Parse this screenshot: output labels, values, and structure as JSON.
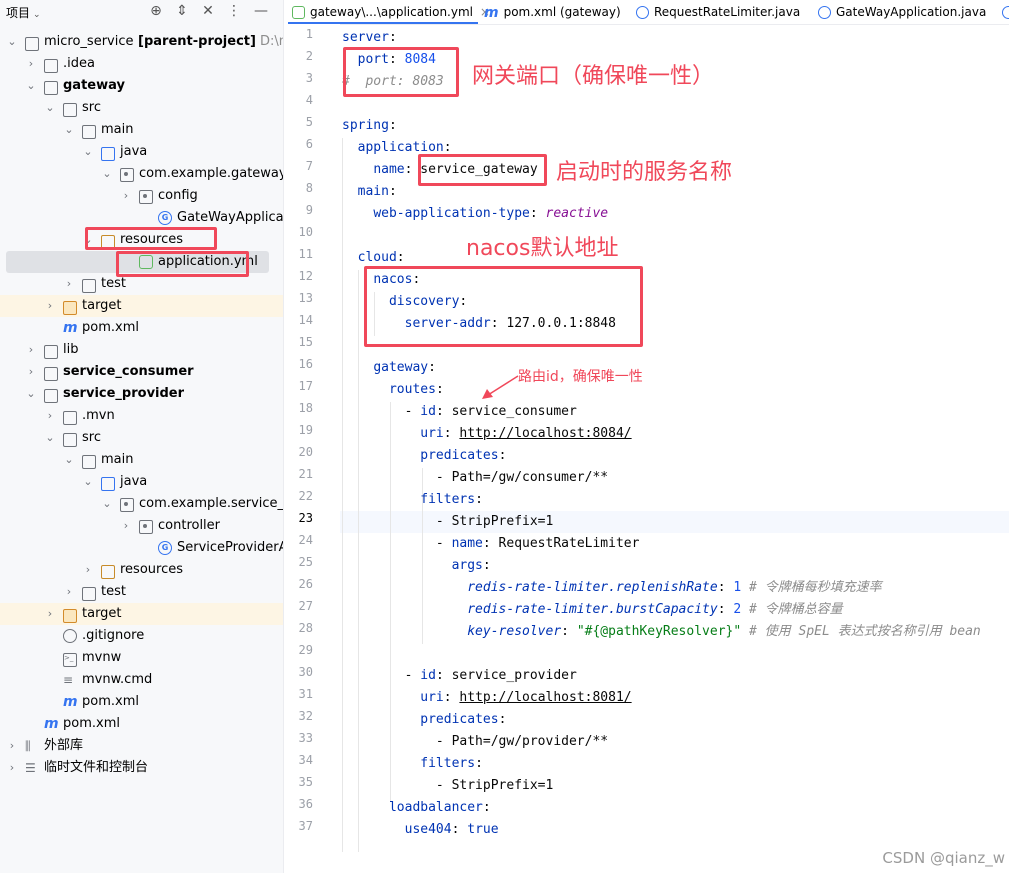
{
  "project_panel": {
    "title": "项目",
    "tree": [
      {
        "label": "micro_service",
        "bold_suffix": "[parent-project]",
        "sub": "D:\\mic",
        "icon": "module-folder-icon",
        "arrow": "▾"
      },
      {
        "label": ".idea",
        "icon": "folder-icon",
        "arrow": "›"
      },
      {
        "label": "gateway",
        "bold": true,
        "icon": "module-folder-icon",
        "arrow": "▾"
      },
      {
        "label": "src",
        "icon": "folder-icon",
        "arrow": "▾"
      },
      {
        "label": "main",
        "icon": "folder-icon",
        "arrow": "▾"
      },
      {
        "label": "java",
        "icon": "source-folder-icon",
        "arrow": "▾"
      },
      {
        "label": "com.example.gateway",
        "icon": "package-icon",
        "arrow": "▾"
      },
      {
        "label": "config",
        "icon": "package-icon",
        "arrow": "›"
      },
      {
        "label": "GateWayApplication",
        "icon": "spring-class-icon",
        "arrow": ""
      },
      {
        "label": "resources",
        "icon": "resources-folder-icon",
        "arrow": "▾"
      },
      {
        "label": "application.yml",
        "icon": "yaml-file-icon",
        "arrow": ""
      },
      {
        "label": "test",
        "icon": "folder-icon",
        "arrow": "›"
      },
      {
        "label": "target",
        "icon": "excluded-folder-icon",
        "arrow": "›"
      },
      {
        "label": "pom.xml",
        "icon": "maven-icon",
        "arrow": ""
      },
      {
        "label": "lib",
        "icon": "folder-icon",
        "arrow": "›"
      },
      {
        "label": "service_consumer",
        "bold": true,
        "icon": "module-folder-icon",
        "arrow": "›"
      },
      {
        "label": "service_provider",
        "bold": true,
        "icon": "module-folder-icon",
        "arrow": "▾"
      },
      {
        "label": ".mvn",
        "icon": "folder-icon",
        "arrow": "›"
      },
      {
        "label": "src",
        "icon": "folder-icon",
        "arrow": "▾"
      },
      {
        "label": "main",
        "icon": "folder-icon",
        "arrow": "▾"
      },
      {
        "label": "java",
        "icon": "source-folder-icon",
        "arrow": "▾"
      },
      {
        "label": "com.example.service_p",
        "icon": "package-icon",
        "arrow": "▾"
      },
      {
        "label": "controller",
        "icon": "package-icon",
        "arrow": "›"
      },
      {
        "label": "ServiceProviderApp",
        "icon": "spring-class-icon",
        "arrow": ""
      },
      {
        "label": "resources",
        "icon": "resources-folder-icon",
        "arrow": "›"
      },
      {
        "label": "test",
        "icon": "folder-icon",
        "arrow": "›"
      },
      {
        "label": "target",
        "icon": "excluded-folder-icon",
        "arrow": "›"
      },
      {
        "label": ".gitignore",
        "icon": "gitignore-icon",
        "arrow": ""
      },
      {
        "label": "mvnw",
        "icon": "terminal-file-icon",
        "arrow": ""
      },
      {
        "label": "mvnw.cmd",
        "icon": "text-file-icon",
        "arrow": ""
      },
      {
        "label": "pom.xml",
        "icon": "maven-icon",
        "arrow": ""
      },
      {
        "label": "pom.xml",
        "icon": "maven-icon",
        "arrow": ""
      },
      {
        "label": "外部库",
        "icon": "library-icon",
        "arrow": "›"
      },
      {
        "label": "临时文件和控制台",
        "icon": "scratches-icon",
        "arrow": "›"
      }
    ]
  },
  "tabs": [
    {
      "label": "gateway\\...\\application.yml",
      "icon": "yaml-file-icon",
      "active": true,
      "close": "×"
    },
    {
      "label": "pom.xml (gateway)",
      "icon": "maven-icon"
    },
    {
      "label": "RequestRateLimiter.java",
      "icon": "class-icon"
    },
    {
      "label": "GateWayApplication.java",
      "icon": "spring-class-icon"
    }
  ],
  "editor": {
    "current_line": 23,
    "line_numbers": [
      "1",
      "2",
      "3",
      "4",
      "5",
      "6",
      "7",
      "8",
      "9",
      "10",
      "11",
      "12",
      "13",
      "14",
      "15",
      "16",
      "17",
      "18",
      "19",
      "20",
      "21",
      "22",
      "23",
      "24",
      "25",
      "26",
      "27",
      "28",
      "29",
      "30",
      "31",
      "32",
      "33",
      "34",
      "35",
      "36",
      "37"
    ],
    "lines": [
      [
        {
          "t": "server",
          "c": "k"
        },
        {
          "t": ":"
        }
      ],
      [
        {
          "t": "  "
        },
        {
          "t": "port",
          "c": "k"
        },
        {
          "t": ": "
        },
        {
          "t": "8084",
          "c": "n"
        }
      ],
      [
        {
          "t": "#  port: 8083",
          "c": "cm"
        }
      ],
      [],
      [
        {
          "t": "spring",
          "c": "k"
        },
        {
          "t": ":"
        }
      ],
      [
        {
          "t": "  "
        },
        {
          "t": "application",
          "c": "k"
        },
        {
          "t": ":"
        }
      ],
      [
        {
          "t": "    "
        },
        {
          "t": "name",
          "c": "k"
        },
        {
          "t": ": "
        },
        {
          "t": "service_gateway"
        }
      ],
      [
        {
          "t": "  "
        },
        {
          "t": "main",
          "c": "k"
        },
        {
          "t": ":"
        }
      ],
      [
        {
          "t": "    "
        },
        {
          "t": "web-application-type",
          "c": "k"
        },
        {
          "t": ": "
        },
        {
          "t": "reactive",
          "c": "it"
        }
      ],
      [],
      [
        {
          "t": "  "
        },
        {
          "t": "cloud",
          "c": "k"
        },
        {
          "t": ":"
        }
      ],
      [
        {
          "t": "    "
        },
        {
          "t": "nacos",
          "c": "k"
        },
        {
          "t": ":"
        }
      ],
      [
        {
          "t": "      "
        },
        {
          "t": "discovery",
          "c": "k"
        },
        {
          "t": ":"
        }
      ],
      [
        {
          "t": "        "
        },
        {
          "t": "server-addr",
          "c": "k"
        },
        {
          "t": ": "
        },
        {
          "t": "127.0.0.1:8848"
        }
      ],
      [],
      [
        {
          "t": "    "
        },
        {
          "t": "gateway",
          "c": "k"
        },
        {
          "t": ":"
        }
      ],
      [
        {
          "t": "      "
        },
        {
          "t": "routes",
          "c": "k"
        },
        {
          "t": ":"
        }
      ],
      [
        {
          "t": "        - "
        },
        {
          "t": "id",
          "c": "k"
        },
        {
          "t": ": "
        },
        {
          "t": "service_consumer"
        }
      ],
      [
        {
          "t": "          "
        },
        {
          "t": "uri",
          "c": "k"
        },
        {
          "t": ": "
        },
        {
          "t": "http://localhost:8084/",
          "c": "u"
        }
      ],
      [
        {
          "t": "          "
        },
        {
          "t": "predicates",
          "c": "k"
        },
        {
          "t": ":"
        }
      ],
      [
        {
          "t": "            - "
        },
        {
          "t": "Path=/gw/consumer/**"
        }
      ],
      [
        {
          "t": "          "
        },
        {
          "t": "filters",
          "c": "k"
        },
        {
          "t": ":"
        }
      ],
      [
        {
          "t": "            - "
        },
        {
          "t": "StripPrefix=1"
        }
      ],
      [
        {
          "t": "            - "
        },
        {
          "t": "name",
          "c": "k"
        },
        {
          "t": ": "
        },
        {
          "t": "RequestRateLimiter"
        }
      ],
      [
        {
          "t": "              "
        },
        {
          "t": "args",
          "c": "k"
        },
        {
          "t": ":"
        }
      ],
      [
        {
          "t": "                "
        },
        {
          "t": "redis-rate-limiter.replenishRate",
          "c": "ik"
        },
        {
          "t": ": "
        },
        {
          "t": "1",
          "c": "n"
        },
        {
          "t": " # 令牌桶每秒填充速率",
          "c": "cm"
        }
      ],
      [
        {
          "t": "                "
        },
        {
          "t": "redis-rate-limiter.burstCapacity",
          "c": "ik"
        },
        {
          "t": ": "
        },
        {
          "t": "2",
          "c": "n"
        },
        {
          "t": " # 令牌桶总容量",
          "c": "cm"
        }
      ],
      [
        {
          "t": "                "
        },
        {
          "t": "key-resolver",
          "c": "ik"
        },
        {
          "t": ": "
        },
        {
          "t": "\"#{@pathKeyResolver}\"",
          "c": "v"
        },
        {
          "t": " # 使用 SpEL 表达式按名称引用 bean",
          "c": "cm"
        }
      ],
      [],
      [
        {
          "t": "        - "
        },
        {
          "t": "id",
          "c": "k"
        },
        {
          "t": ": "
        },
        {
          "t": "service_provider"
        }
      ],
      [
        {
          "t": "          "
        },
        {
          "t": "uri",
          "c": "k"
        },
        {
          "t": ": "
        },
        {
          "t": "http://localhost:8081/",
          "c": "u"
        }
      ],
      [
        {
          "t": "          "
        },
        {
          "t": "predicates",
          "c": "k"
        },
        {
          "t": ":"
        }
      ],
      [
        {
          "t": "            - "
        },
        {
          "t": "Path=/gw/provider/**"
        }
      ],
      [
        {
          "t": "          "
        },
        {
          "t": "filters",
          "c": "k"
        },
        {
          "t": ":"
        }
      ],
      [
        {
          "t": "            - "
        },
        {
          "t": "StripPrefix=1"
        }
      ],
      [
        {
          "t": "      "
        },
        {
          "t": "loadbalancer",
          "c": "k"
        },
        {
          "t": ":"
        }
      ],
      [
        {
          "t": "        "
        },
        {
          "t": "use404",
          "c": "k"
        },
        {
          "t": ": "
        },
        {
          "t": "true",
          "c": "k"
        }
      ]
    ]
  },
  "annotations": {
    "port": "网关端口（确保唯一性）",
    "name": "启动时的服务名称",
    "nacos": "nacos默认地址",
    "route_id": "路由id，确保唯一性"
  },
  "watermark": "CSDN @qianz_w",
  "colors": {
    "annotation_red": "#f0485a",
    "accent": "#3574f0",
    "keyword": "#0033b3"
  }
}
